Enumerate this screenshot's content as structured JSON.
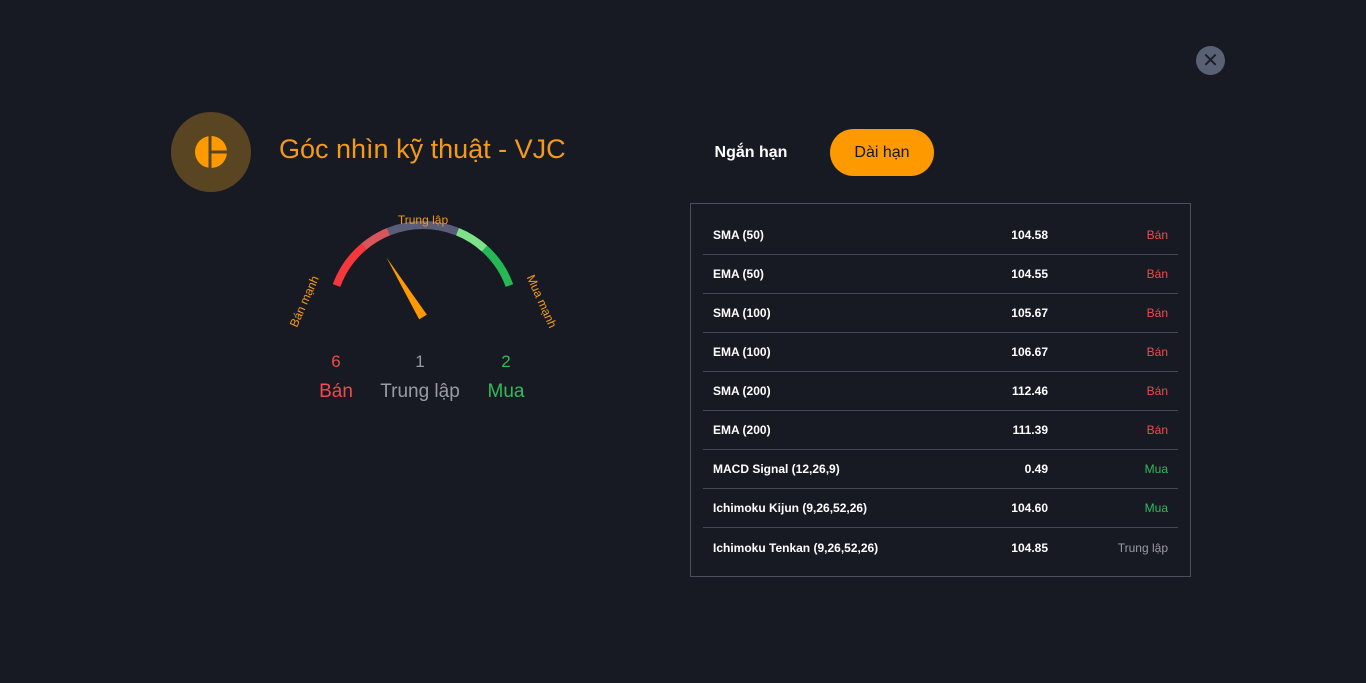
{
  "header": {
    "logo_icon": "pie-chart-icon",
    "title": "Góc nhìn kỹ thuật - VJC",
    "close_icon": "close-icon"
  },
  "tabs": [
    {
      "label": "Ngắn hạn",
      "active": false
    },
    {
      "label": "Dài hạn",
      "active": true
    }
  ],
  "gauge": {
    "label_left": "Bán mạnh",
    "label_top": "Trung lập",
    "label_right": "Mua mạnh",
    "needle_value": -0.45,
    "colors": {
      "strong_sell": "#f5383c",
      "sell": "#d8555b",
      "neutral": "#5a5d78",
      "buy": "#7de28a",
      "strong_buy": "#26b855",
      "needle": "#ff9900",
      "label": "#f39a1b"
    }
  },
  "summary": {
    "sell": {
      "count": "6",
      "label": "Bán",
      "color": "#f04a4c"
    },
    "neutral": {
      "count": "1",
      "label": "Trung lập",
      "color": "#9a9aa6"
    },
    "buy": {
      "count": "2",
      "label": "Mua",
      "color": "#2fbb5b"
    }
  },
  "indicators": [
    {
      "name": "SMA (50)",
      "value": "104.58",
      "signal": "Bán",
      "kind": "sell"
    },
    {
      "name": "EMA (50)",
      "value": "104.55",
      "signal": "Bán",
      "kind": "sell"
    },
    {
      "name": "SMA (100)",
      "value": "105.67",
      "signal": "Bán",
      "kind": "sell"
    },
    {
      "name": "EMA (100)",
      "value": "106.67",
      "signal": "Bán",
      "kind": "sell"
    },
    {
      "name": "SMA (200)",
      "value": "112.46",
      "signal": "Bán",
      "kind": "sell"
    },
    {
      "name": "EMA (200)",
      "value": "111.39",
      "signal": "Bán",
      "kind": "sell"
    },
    {
      "name": "MACD Signal (12,26,9)",
      "value": "0.49",
      "signal": "Mua",
      "kind": "buy"
    },
    {
      "name": "Ichimoku Kijun (9,26,52,26)",
      "value": "104.60",
      "signal": "Mua",
      "kind": "buy"
    },
    {
      "name": "Ichimoku Tenkan (9,26,52,26)",
      "value": "104.85",
      "signal": "Trung lập",
      "kind": "neutral"
    }
  ],
  "signal_colors": {
    "sell": "#f04a4c",
    "buy": "#2fbb5b",
    "neutral": "#9a9aa6"
  }
}
